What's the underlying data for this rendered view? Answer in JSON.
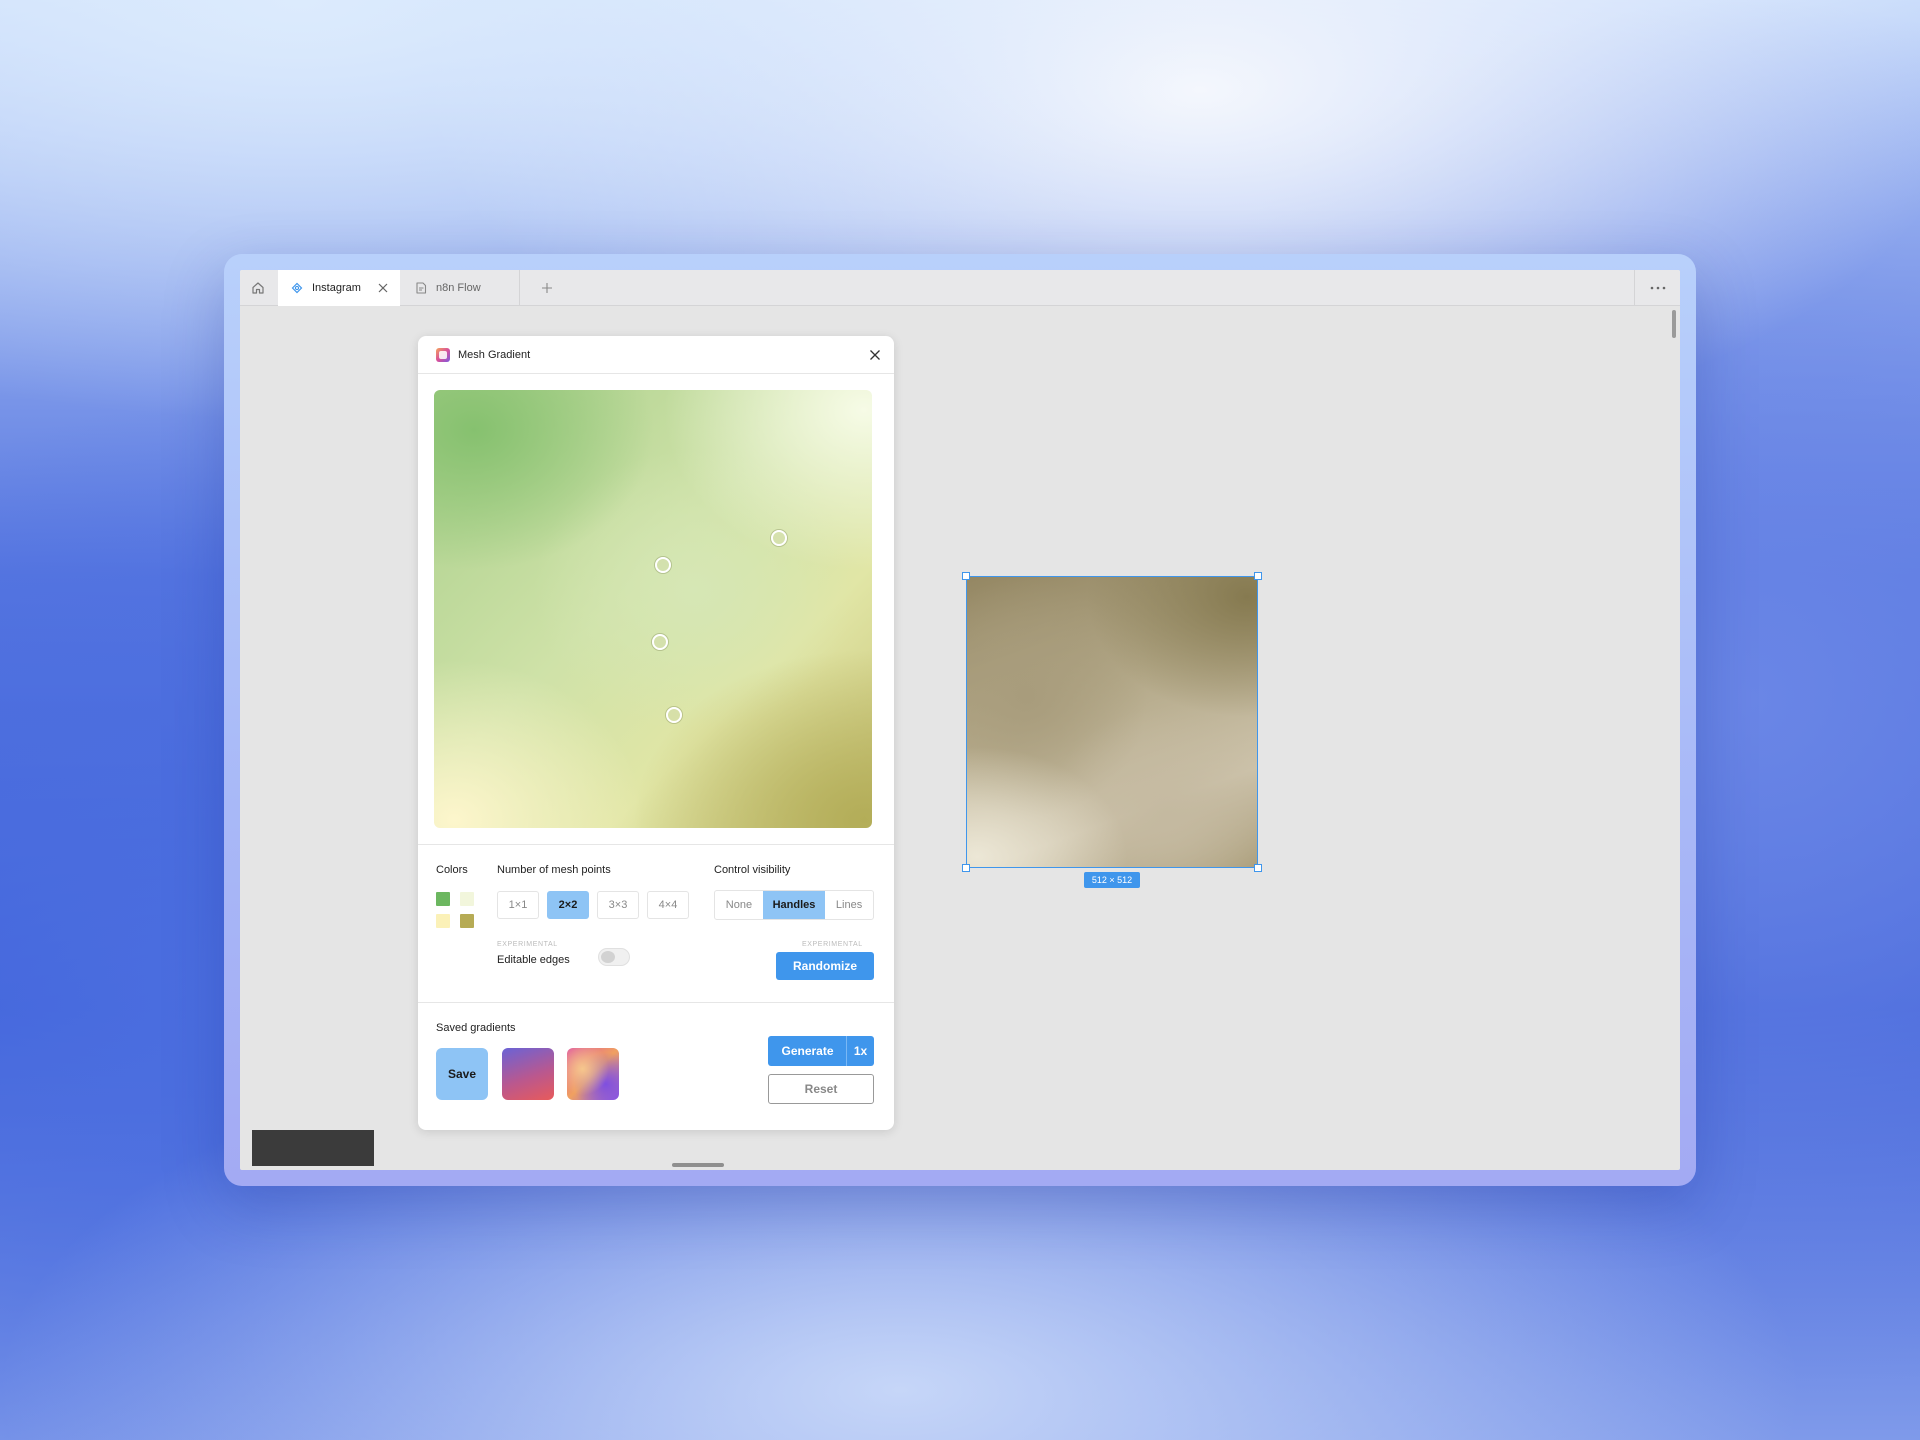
{
  "tabs": [
    {
      "label": "Instagram",
      "active": true
    },
    {
      "label": "n8n Flow",
      "active": false
    }
  ],
  "panel": {
    "title": "Mesh Gradient",
    "colors_label": "Colors",
    "swatches": [
      "#6cb760",
      "#f2f6dc",
      "#fbf1b8",
      "#b6ab55"
    ],
    "mesh_label": "Number of mesh points",
    "mesh_options": [
      "1×1",
      "2×2",
      "3×3",
      "4×4"
    ],
    "mesh_selected": "2×2",
    "visibility_label": "Control visibility",
    "visibility_options": [
      "None",
      "Handles",
      "Lines"
    ],
    "visibility_selected": "Handles",
    "experimental_1": "EXPERIMENTAL",
    "editable_edges_label": "Editable edges",
    "editable_edges_on": false,
    "experimental_2": "EXPERIMENTAL",
    "randomize_label": "Randomize",
    "saved_label": "Saved gradients",
    "save_label": "Save",
    "generate_label": "Generate",
    "scale_label": "1x",
    "reset_label": "Reset"
  },
  "frame": {
    "dimensions": "512 × 512"
  },
  "colors": {
    "accent": "#3f96ec",
    "selected": "#8ec4f5"
  }
}
